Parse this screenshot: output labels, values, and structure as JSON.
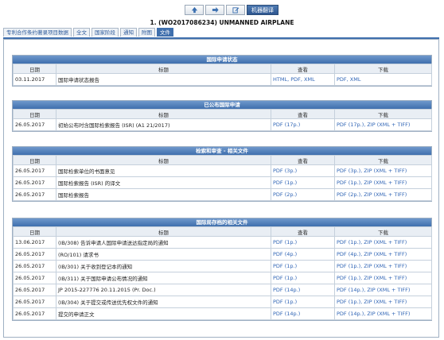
{
  "toolbar": {
    "machine_translate_label": "机器翻译"
  },
  "doc_title": "1. (WO2017086234) UNMANNED AIRPLANE",
  "tabs": [
    "专利合作条约著录项目数据",
    "全文",
    "国家阶段",
    "通知",
    "附图",
    "文件"
  ],
  "headers": {
    "date": "日期",
    "title": "标题",
    "view": "查看",
    "download": "下载"
  },
  "sections": [
    {
      "title": "国际申请状态",
      "rows": [
        {
          "date": "03.11.2017",
          "title": "国际申请状态报告",
          "view": "HTML, PDF, XML",
          "download": "PDF, XML"
        }
      ]
    },
    {
      "title": "已公布国际申请",
      "rows": [
        {
          "date": "26.05.2017",
          "title": "初始公布时含国际检索报告 (ISR) (A1 21/2017)",
          "view": "PDF (17p.)",
          "download": "PDF (17p.), ZIP (XML + TIFF)"
        }
      ]
    },
    {
      "title": "检索和审查 - 相关文件",
      "rows": [
        {
          "date": "26.05.2017",
          "title": "国际检索单位的书面意见",
          "view": "PDF (3p.)",
          "download": "PDF (3p.), ZIP (XML + TIFF)"
        },
        {
          "date": "26.05.2017",
          "title": "国际检索报告 (ISR) 的译文",
          "view": "PDF (1p.)",
          "download": "PDF (1p.), ZIP (XML + TIFF)"
        },
        {
          "date": "26.05.2017",
          "title": "国际检索报告",
          "view": "PDF (2p.)",
          "download": "PDF (2p.), ZIP (XML + TIFF)"
        }
      ]
    },
    {
      "title": "国际局存档的相关文件",
      "rows": [
        {
          "date": "13.06.2017",
          "title": "(IB/308) 告诉申请人国际申请送达指定局的通知",
          "view": "PDF (1p.)",
          "download": "PDF (1p.), ZIP (XML + TIFF)"
        },
        {
          "date": "26.05.2017",
          "title": "(RO/101) 请求书",
          "view": "PDF (4p.)",
          "download": "PDF (4p.), ZIP (XML + TIFF)"
        },
        {
          "date": "26.05.2017",
          "title": "(IB/301) 关于收到登记本的通知",
          "view": "PDF (1p.)",
          "download": "PDF (1p.), ZIP (XML + TIFF)"
        },
        {
          "date": "26.05.2017",
          "title": "(IB/311) 关于国际申请公布情况的通知",
          "view": "PDF (1p.)",
          "download": "PDF (1p.), ZIP (XML + TIFF)"
        },
        {
          "date": "26.05.2017",
          "title": "JP 2015-227776 20.11.2015 (Pr. Doc.)",
          "view": "PDF (14p.)",
          "download": "PDF (14p.), ZIP (XML + TIFF)"
        },
        {
          "date": "26.05.2017",
          "title": "(IB/304) 关于提交或传送优先权文件的通知",
          "view": "PDF (1p.)",
          "download": "PDF (1p.), ZIP (XML + TIFF)"
        },
        {
          "date": "26.05.2017",
          "title": "提交的申请正文",
          "view": "PDF (14p.)",
          "download": "PDF (14p.), ZIP (XML + TIFF)"
        }
      ]
    }
  ]
}
